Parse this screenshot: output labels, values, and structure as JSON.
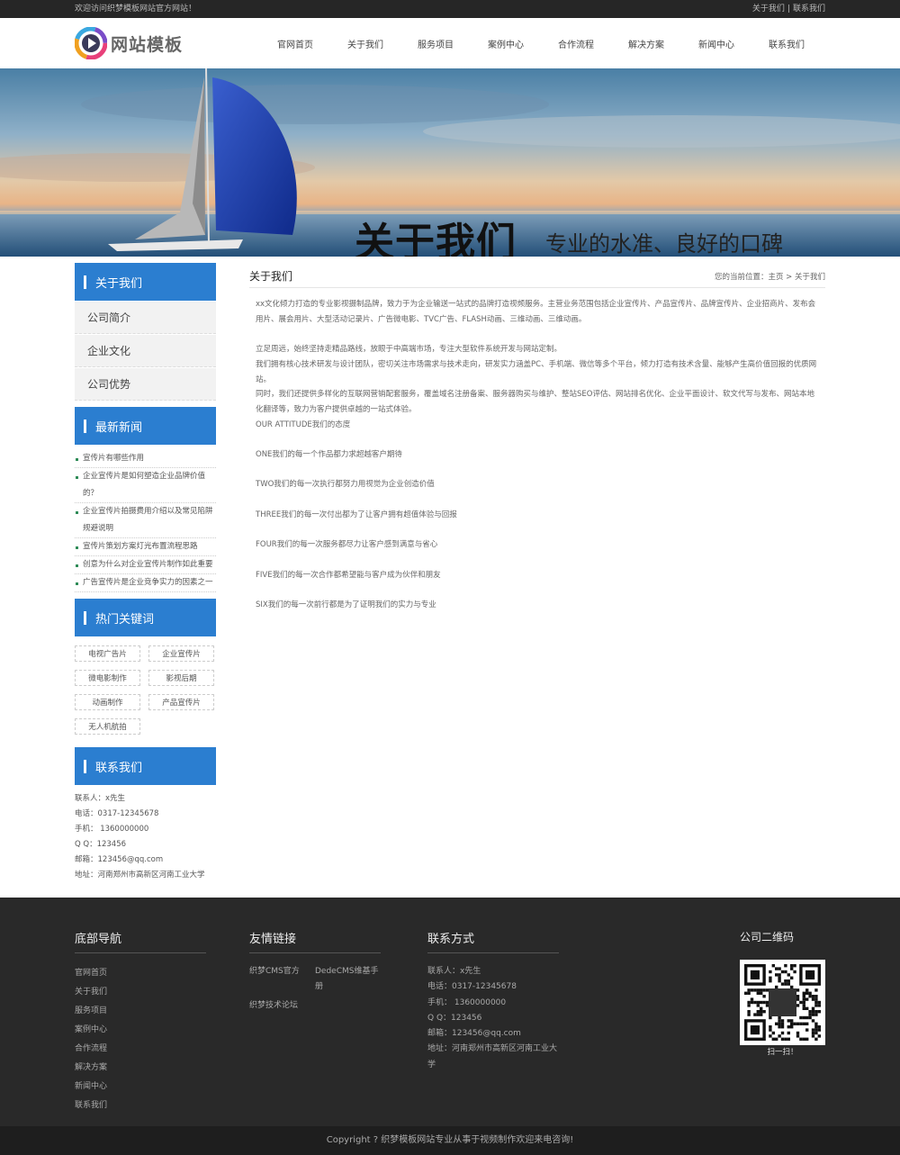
{
  "topbar": {
    "welcome": "欢迎访问织梦模板网站官方网站！",
    "about_link": "关于我们",
    "separator": "|",
    "contact_link": "联系我们"
  },
  "header": {
    "logo_text": "网站模板",
    "nav": [
      "官网首页",
      "关于我们",
      "服务项目",
      "案例中心",
      "合作流程",
      "解决方案",
      "新闻中心",
      "联系我们"
    ]
  },
  "banner": {
    "title": "关于我们",
    "subtitle": "专业的水准、良好的口碑"
  },
  "sidebar": {
    "about": {
      "title": "关于我们",
      "items": [
        "公司简介",
        "企业文化",
        "公司优势"
      ]
    },
    "news": {
      "title": "最新新闻",
      "items": [
        "宣传片有哪些作用",
        "企业宣传片是如何塑造企业品牌价值的？",
        "企业宣传片拍摄费用介绍以及常见陷阱规避说明",
        "宣传片策划方案灯光布置流程思路",
        "创意为什么对企业宣传片制作如此重要",
        "广告宣传片是企业竞争实力的因素之一"
      ]
    },
    "keywords": {
      "title": "热门关键词",
      "items": [
        "电视广告片",
        "企业宣传片",
        "微电影制作",
        "影视后期",
        "动画制作",
        "产品宣传片",
        "无人机航拍"
      ]
    },
    "contact": {
      "title": "联系我们",
      "lines": [
        "联系人：x先生",
        "电话：0317-12345678",
        "手机： 1360000000",
        "Q  Q：123456",
        "邮箱：123456@qq.com",
        "地址：河南郑州市高新区河南工业大学"
      ]
    }
  },
  "content": {
    "title": "关于我们",
    "breadcrumb": "您的当前位置：主页 > 关于我们",
    "paragraphs": [
      "xx文化倾力打造的专业影视摄制品牌，致力于为企业输送一站式的品牌打造视频服务。主营业务范围包括企业宣传片、产品宣传片、品牌宣传片、企业招商片、发布会用片、展会用片、大型活动记录片、广告微电影、TVC广告、FLASH动画、三维动画、三维动画。",
      "",
      "立足周远，始终坚持走精品路线，放眼于中高端市场，专注大型软件系统开发与网站定制。",
      "我们拥有核心技术研发与设计团队，密切关注市场需求与技术走向，研发实力涵盖PC、手机端、微信等多个平台，倾力打造有技术含量、能够产生高价值回报的优质网站。",
      "同时，我们还提供多样化的互联网营销配套服务，覆盖域名注册备案、服务器购买与维护、整站SEO评估、网站排名优化、企业平面设计、软文代写与发布、网站本地化翻译等，致力为客户提供卓越的一站式体验。",
      "OUR ATTITUDE我们的态度",
      "",
      "ONE我们的每一个作品都力求超越客户期待",
      "",
      "TWO我们的每一次执行都努力用视觉为企业创造价值",
      "",
      "THREE我们的每一次付出都为了让客户拥有超值体验与回报",
      "",
      "FOUR我们的每一次服务都尽力让客户感到满意与省心",
      "",
      "FIVE我们的每一次合作都希望能与客户成为伙伴和朋友",
      "",
      "SIX我们的每一次前行都是为了证明我们的实力与专业"
    ]
  },
  "footer": {
    "nav": {
      "title": "底部导航",
      "items": [
        "官网首页",
        "关于我们",
        "服务项目",
        "案例中心",
        "合作流程",
        "解决方案",
        "新闻中心",
        "联系我们"
      ]
    },
    "friends": {
      "title": "友情链接",
      "items": [
        "织梦CMS官方",
        "DedeCMS维基手册",
        "织梦技术论坛"
      ]
    },
    "contact": {
      "title": "联系方式",
      "lines": [
        "联系人：x先生",
        "电话：0317-12345678",
        "手机： 1360000000",
        "Q  Q：123456",
        "邮箱：123456@qq.com",
        "地址：河南郑州市高新区河南工业大学"
      ]
    },
    "qrcode": {
      "title": "公司二维码",
      "caption": "扫一扫！"
    },
    "copyright": "Copyright ? 织梦模板网站专业从事于视频制作欢迎来电咨询!"
  },
  "colors": {
    "accent_blue": "#2b7ed0",
    "topbar_bg": "#262626",
    "footer_bg": "#292929"
  }
}
